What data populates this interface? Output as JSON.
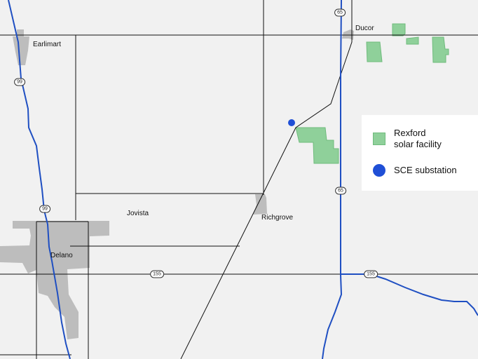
{
  "places": {
    "earlimart": "Earlimart",
    "ducor": "Ducor",
    "jovista": "Jovista",
    "richgrove": "Richgrove",
    "delano": "Delano"
  },
  "shields": {
    "hwy99_north": "99",
    "hwy99_south": "99",
    "hwy65_north": "65",
    "hwy65_south": "65",
    "hwy155_west": "155",
    "hwy155_east": "155"
  },
  "legend": {
    "solar_label_line1": "Rexford",
    "solar_label_line2": "solar facility",
    "substation_label": "SCE substation"
  },
  "colors": {
    "background": "#f1f1f1",
    "urban_area": "#bdbdbd",
    "highway": "#1f4fc2",
    "solar_facility": "#8fd09a",
    "substation": "#1f4fd6"
  }
}
